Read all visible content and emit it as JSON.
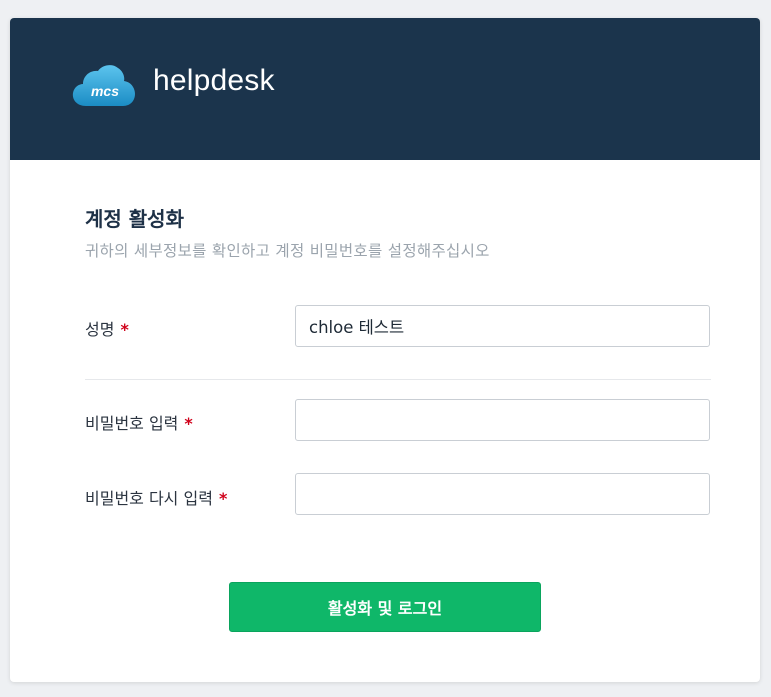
{
  "header": {
    "logo_text": "mcs",
    "app_name": "helpdesk"
  },
  "form": {
    "title": "계정 활성화",
    "subtitle": "귀하의 세부정보를 확인하고 계정 비밀번호를 설정해주십시오",
    "required_mark": "*",
    "fields": [
      {
        "label": "성명",
        "value": "chloe 테스트",
        "placeholder": ""
      },
      {
        "label": "비밀번호 입력",
        "value": "",
        "placeholder": ""
      },
      {
        "label": "비밀번호 다시 입력",
        "value": "",
        "placeholder": ""
      }
    ],
    "submit_label": "활성화 및 로그인"
  },
  "colors": {
    "header_bg": "#1b344c",
    "accent_green": "#0fb769",
    "required_red": "#d0021b",
    "logo_blue": "#2aa3d8"
  },
  "icons": {
    "logo": "cloud-logo-icon"
  }
}
